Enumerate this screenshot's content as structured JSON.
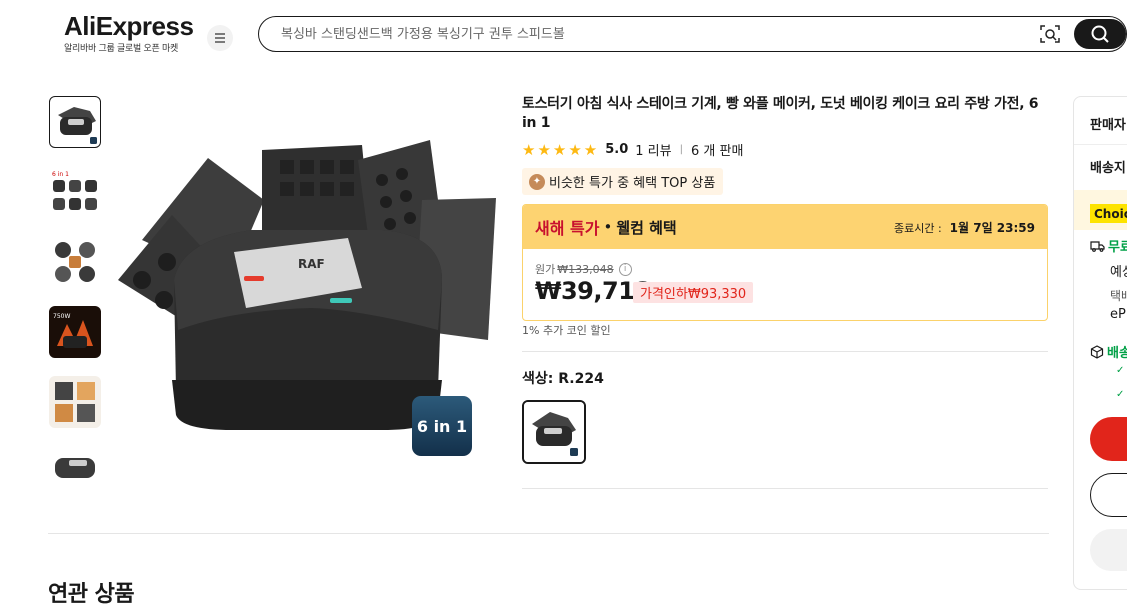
{
  "header": {
    "logo_text": "AliExpress",
    "logo_subtitle": "알리바바 그룹 글로벌 오픈 마켓",
    "menu_icon": "hamburger-icon",
    "search_placeholder": "복싱바 스탠딩샌드백 가정용 복싱기구 권투 스피드볼",
    "image_search_icon": "camera-scan-icon",
    "search_icon": "search-icon"
  },
  "gallery": {
    "thumbnails": [
      "sandwich maker",
      "6 in 1 plates",
      "waffle plates",
      "750W heating",
      "size view",
      "side view"
    ],
    "selected_index": 0,
    "main_badge": "6 in 1",
    "brand_on_device": "RAF"
  },
  "product": {
    "title": "토스터기 아침 식사 스테이크 기계, 빵 와플 메이커, 도넛 베이킹 케이크 요리 주방 가전, 6 in 1",
    "rating_value": "5.0",
    "rating_stars": 5,
    "reviews": "1 리뷰",
    "sold": "6 개 판매",
    "top_badge": "비슷한 특가 중 혜택 TOP 상품"
  },
  "deal": {
    "title": "새해 특가",
    "dot": "•",
    "subtitle": "웰컴 혜택",
    "end_label": "종료시간 :",
    "end_time": "1월 7일 23:59",
    "original_label": "원가",
    "original_price": "₩133,048",
    "price": "₩39,718",
    "price_cut": "가격인하₩93,330",
    "coin_discount": "1% 추가 코인 할인",
    "accent_red": "#c8102e",
    "header_color": "#fdd371"
  },
  "options": {
    "color_label": "색상: R.224"
  },
  "related": {
    "title": "연관 상품"
  },
  "right_panel": {
    "seller": "판매자",
    "shipping_label": "배송지",
    "choice_label": "Choic",
    "free_shipping": "무료",
    "estimate": "예상",
    "carrier": "택배",
    "ep": "eP",
    "promise": "배송"
  }
}
